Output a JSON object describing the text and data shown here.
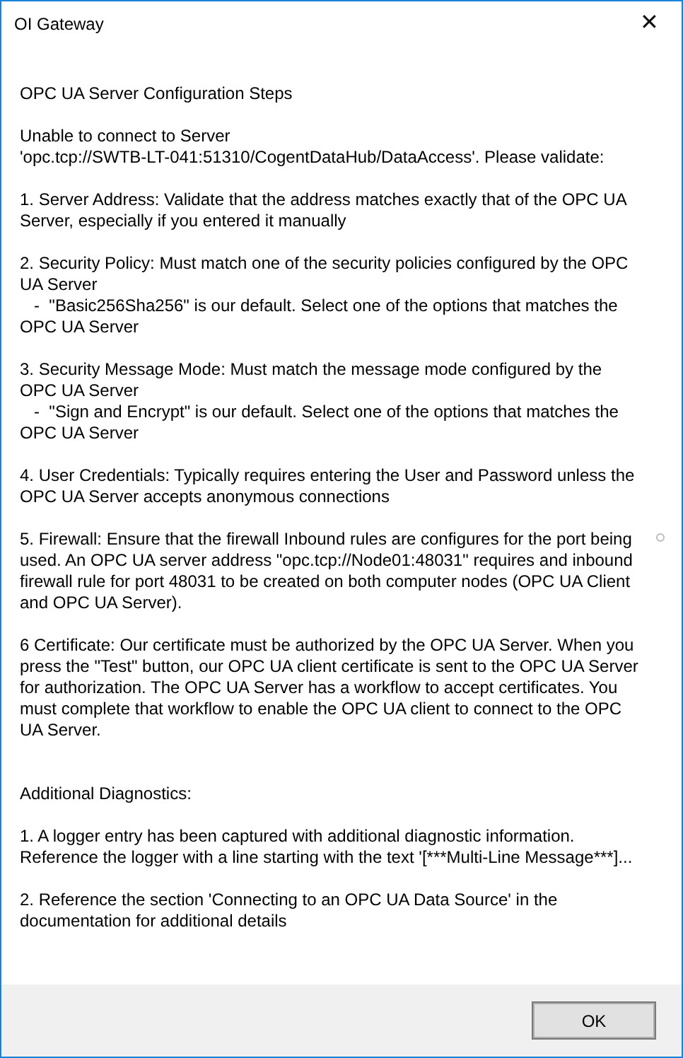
{
  "window": {
    "title": "OI Gateway",
    "close": "✕"
  },
  "message": [
    {
      "kind": "heading",
      "text": "OPC UA Server Configuration Steps"
    },
    {
      "kind": "text",
      "text": "Unable to connect to Server\n'opc.tcp://SWTB-LT-041:51310/CogentDataHub/DataAccess'. Please validate:"
    },
    {
      "kind": "text",
      "text": "1. Server Address: Validate that the address matches exactly that of the OPC UA Server, especially if you entered it manually"
    },
    {
      "kind": "text",
      "text": "2. Security Policy: Must match one of the security policies configured by the OPC UA Server\n   -  \"Basic256Sha256\" is our default. Select one of the options that matches the OPC UA Server"
    },
    {
      "kind": "text",
      "text": "3. Security Message Mode: Must match the message mode configured by the OPC UA Server\n   -  \"Sign and Encrypt\" is our default. Select one of the options that matches the OPC UA Server"
    },
    {
      "kind": "text",
      "text": "4. User Credentials: Typically requires entering the User and Password unless the OPC UA Server accepts anonymous connections"
    },
    {
      "kind": "text",
      "text": "5. Firewall: Ensure that the firewall Inbound rules are configures for the port being used. An OPC UA server address \"opc.tcp://Node01:48031\" requires and inbound firewall rule for port 48031 to be created on both computer nodes (OPC UA Client and OPC UA Server)."
    },
    {
      "kind": "text",
      "text": "6 Certificate: Our certificate must be authorized by the OPC UA Server. When you press the \"Test\" button, our OPC UA client certificate is sent to the OPC UA Server for authorization. The OPC UA Server has a workflow to accept certificates. You must complete that workflow to enable the OPC UA client to connect to the OPC UA Server."
    },
    {
      "kind": "heading",
      "text": "Additional Diagnostics:"
    },
    {
      "kind": "text",
      "text": "1. A logger entry has been captured with additional diagnostic information. Reference the logger with a line starting with the text '[***Multi-Line Message***]..."
    },
    {
      "kind": "text",
      "text": "2. Reference the section 'Connecting to an OPC UA Data Source' in the documentation for additional details"
    }
  ],
  "buttons": [
    "OK"
  ]
}
